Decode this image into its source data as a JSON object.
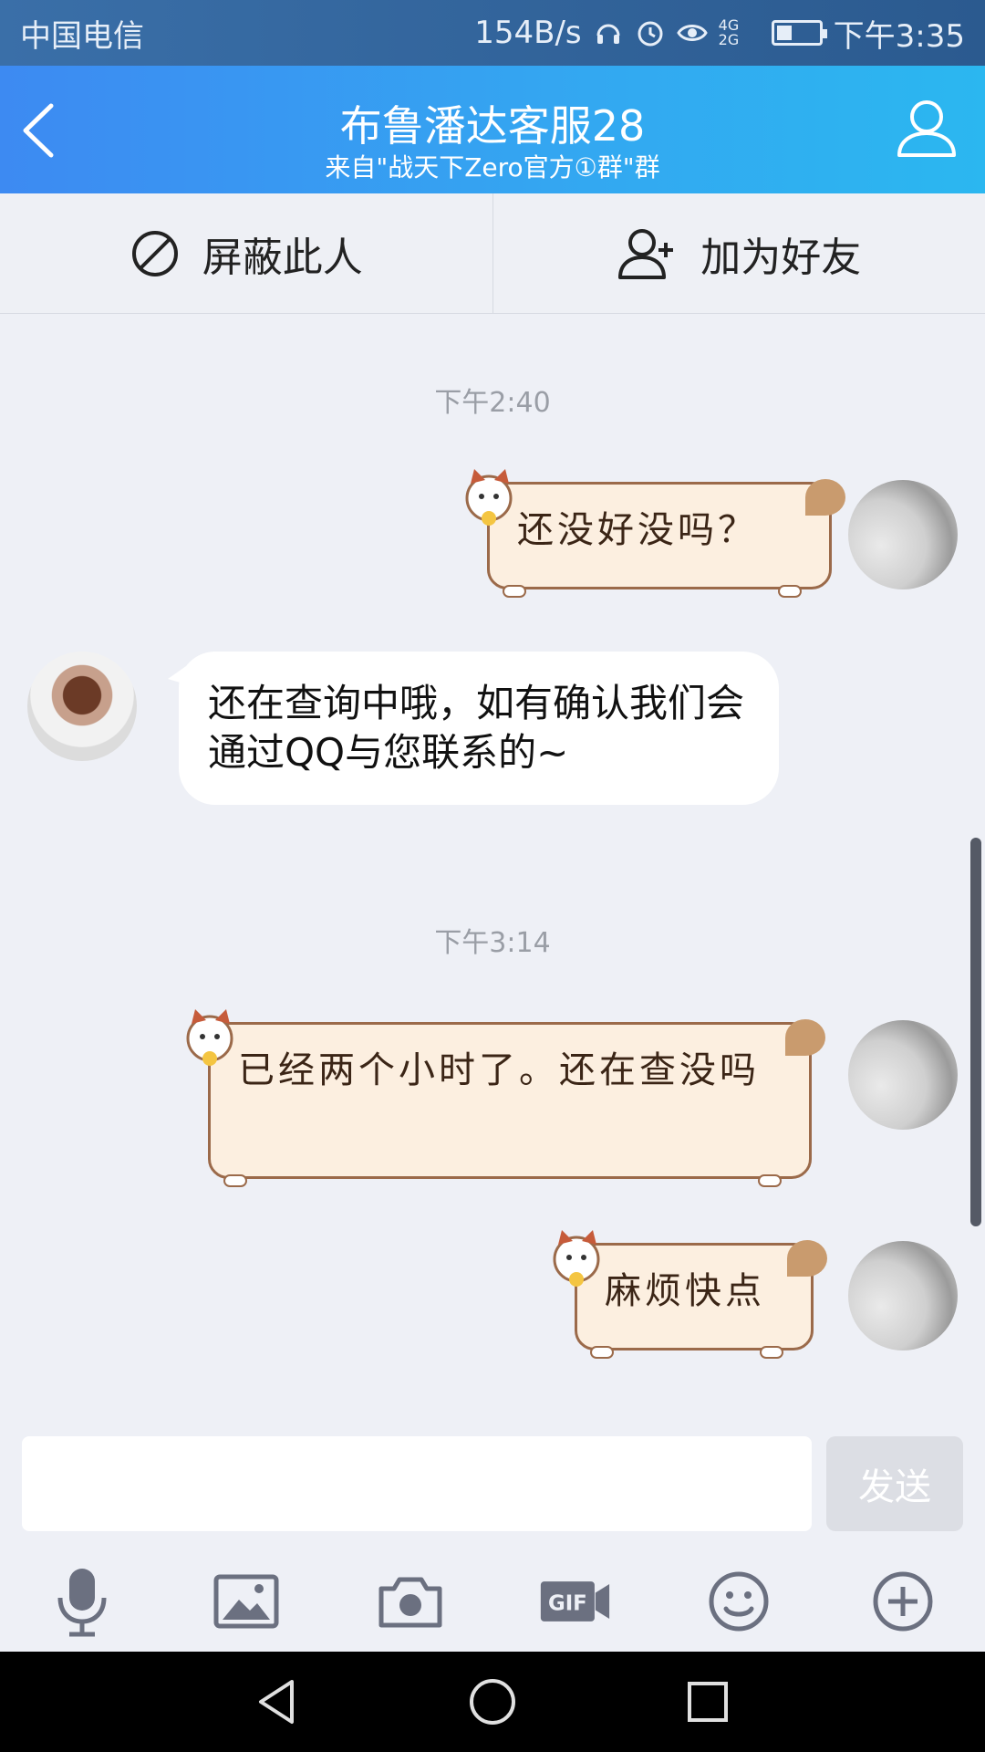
{
  "status_bar": {
    "carrier": "中国电信",
    "speed": "154B/s",
    "network": "4G 2G",
    "time": "下午3:35"
  },
  "header": {
    "title": "布鲁潘达客服28",
    "subtitle": "来自\"战天下Zero官方①群\"群",
    "back_icon": "chevron-left-icon",
    "profile_icon": "user-icon"
  },
  "actions": {
    "block_label": "屏蔽此人",
    "add_friend_label": "加为好友"
  },
  "messages": [
    {
      "type": "timestamp",
      "text": "下午2:40"
    },
    {
      "type": "outgoing",
      "text": "还没好没吗？"
    },
    {
      "type": "incoming",
      "text": "还在查询中哦，如有确认我们会通过QQ与您联系的~"
    },
    {
      "type": "timestamp",
      "text": "下午3:14"
    },
    {
      "type": "outgoing",
      "text": "已经两个小时了。还在查没吗"
    },
    {
      "type": "outgoing",
      "text": "麻烦快点"
    }
  ],
  "composer": {
    "placeholder": "",
    "send_label": "发送"
  },
  "toolbar_icons": [
    "microphone-icon",
    "image-icon",
    "camera-icon",
    "gif-icon",
    "emoji-icon",
    "plus-icon"
  ],
  "colors": {
    "header_start": "#3d8af2",
    "header_end": "#2bb7f0",
    "chat_bg": "#eef0f6",
    "cat_bubble_bg": "#fcefe0"
  }
}
